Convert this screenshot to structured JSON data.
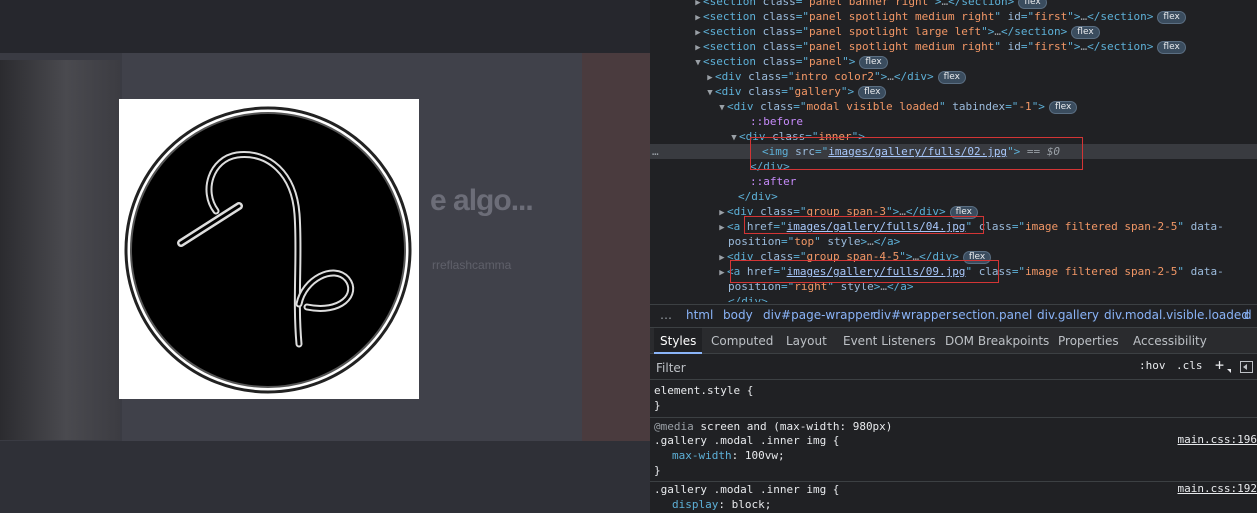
{
  "page": {
    "heading_partial": "e algo...",
    "subtext_partial": "rreflashcamma"
  },
  "elements_panel": {
    "lines": [
      {
        "toggle": "▶",
        "parts": [
          [
            "tg",
            "<section "
          ],
          [
            "an",
            "class"
          ],
          [
            "tg",
            "=\""
          ],
          [
            "av",
            "panel banner right"
          ],
          [
            "tg",
            "\">"
          ],
          [
            "eq",
            "…"
          ],
          [
            "tg",
            "</section>"
          ]
        ],
        "badge": "flex",
        "indent": 54
      },
      {
        "toggle": "▶",
        "parts": [
          [
            "tg",
            "<section "
          ],
          [
            "an",
            "class"
          ],
          [
            "tg",
            "=\""
          ],
          [
            "av",
            "panel spotlight medium right"
          ],
          [
            "tg",
            "\" "
          ],
          [
            "an",
            "id"
          ],
          [
            "tg",
            "=\""
          ],
          [
            "av",
            "first"
          ],
          [
            "tg",
            "\">"
          ],
          [
            "eq",
            "…"
          ],
          [
            "tg",
            "</section>"
          ]
        ],
        "badge": "flex",
        "indent": 54
      },
      {
        "toggle": "▶",
        "parts": [
          [
            "tg",
            "<section "
          ],
          [
            "an",
            "class"
          ],
          [
            "tg",
            "=\""
          ],
          [
            "av",
            "panel spotlight large left"
          ],
          [
            "tg",
            "\">"
          ],
          [
            "eq",
            "…"
          ],
          [
            "tg",
            "</section>"
          ]
        ],
        "badge": "flex",
        "indent": 54
      },
      {
        "toggle": "▶",
        "parts": [
          [
            "tg",
            "<section "
          ],
          [
            "an",
            "class"
          ],
          [
            "tg",
            "=\""
          ],
          [
            "av",
            "panel spotlight medium right"
          ],
          [
            "tg",
            "\" "
          ],
          [
            "an",
            "id"
          ],
          [
            "tg",
            "=\""
          ],
          [
            "av",
            "first"
          ],
          [
            "tg",
            "\">"
          ],
          [
            "eq",
            "…"
          ],
          [
            "tg",
            "</section>"
          ]
        ],
        "badge": "flex",
        "indent": 54
      },
      {
        "toggle": "▼",
        "parts": [
          [
            "tg",
            "<section "
          ],
          [
            "an",
            "class"
          ],
          [
            "tg",
            "=\""
          ],
          [
            "av",
            "panel"
          ],
          [
            "tg",
            "\">"
          ]
        ],
        "badge": "flex",
        "indent": 54
      },
      {
        "toggle": "▶",
        "parts": [
          [
            "tg",
            "<div "
          ],
          [
            "an",
            "class"
          ],
          [
            "tg",
            "=\""
          ],
          [
            "av",
            "intro color2"
          ],
          [
            "tg",
            "\">"
          ],
          [
            "eq",
            "…"
          ],
          [
            "tg",
            "</div>"
          ]
        ],
        "badge": "flex",
        "indent": 66
      },
      {
        "toggle": "▼",
        "parts": [
          [
            "tg",
            "<div "
          ],
          [
            "an",
            "class"
          ],
          [
            "tg",
            "=\""
          ],
          [
            "av",
            "gallery"
          ],
          [
            "tg",
            "\">"
          ]
        ],
        "badge": "flex",
        "indent": 66
      },
      {
        "toggle": "▼",
        "parts": [
          [
            "tg",
            "<div "
          ],
          [
            "an",
            "class"
          ],
          [
            "tg",
            "=\""
          ],
          [
            "av",
            "modal visible loaded"
          ],
          [
            "tg",
            "\" "
          ],
          [
            "an",
            "tabindex"
          ],
          [
            "tg",
            "=\""
          ],
          [
            "av",
            "-1"
          ],
          [
            "tg",
            "\">"
          ]
        ],
        "badge": "flex",
        "indent": 78
      },
      {
        "toggle": "",
        "parts": [
          [
            "pe",
            "::before"
          ]
        ],
        "badge": "",
        "indent": 100
      },
      {
        "toggle": "▼",
        "parts": [
          [
            "tg",
            "<div "
          ],
          [
            "an",
            "class"
          ],
          [
            "tg",
            "=\""
          ],
          [
            "av",
            "inner"
          ],
          [
            "tg",
            "\">"
          ]
        ],
        "badge": "",
        "indent": 90
      },
      {
        "toggle": "",
        "parts": [
          [
            "tg",
            "<img "
          ],
          [
            "an",
            "src"
          ],
          [
            "tg",
            "=\""
          ],
          [
            "avl",
            "images/gallery/fulls/02.jpg"
          ],
          [
            "tg",
            "\">"
          ],
          [
            "eq",
            " == "
          ],
          [
            "eqv",
            "$0"
          ]
        ],
        "badge": "",
        "indent": 112,
        "selected": true
      },
      {
        "toggle": "",
        "parts": [
          [
            "tg",
            "</div>"
          ]
        ],
        "badge": "",
        "indent": 100
      },
      {
        "toggle": "",
        "parts": [
          [
            "pe",
            "::after"
          ]
        ],
        "badge": "",
        "indent": 100
      },
      {
        "toggle": "",
        "parts": [
          [
            "tg",
            "</div>"
          ]
        ],
        "badge": "",
        "indent": 88
      },
      {
        "toggle": "▶",
        "parts": [
          [
            "tg",
            "<div "
          ],
          [
            "an",
            "class"
          ],
          [
            "tg",
            "=\""
          ],
          [
            "av",
            "group span-3"
          ],
          [
            "tg",
            "\">"
          ],
          [
            "eq",
            "…"
          ],
          [
            "tg",
            "</div>"
          ]
        ],
        "badge": "flex",
        "indent": 78
      },
      {
        "toggle": "▶",
        "parts": [
          [
            "tg",
            "<a "
          ],
          [
            "an",
            "href"
          ],
          [
            "tg",
            "=\""
          ],
          [
            "avl",
            "images/gallery/fulls/04.jpg"
          ],
          [
            "tg",
            "\" "
          ],
          [
            "an",
            "class"
          ],
          [
            "tg",
            "=\""
          ],
          [
            "av",
            "image filtered span-2-5"
          ],
          [
            "tg",
            "\" "
          ],
          [
            "an",
            "data-"
          ]
        ],
        "badge": "",
        "indent": 78
      },
      {
        "toggle": "",
        "parts": [
          [
            "an",
            "position"
          ],
          [
            "tg",
            "=\""
          ],
          [
            "av",
            "top"
          ],
          [
            "tg",
            "\" "
          ],
          [
            "an",
            "style"
          ],
          [
            "tg",
            ">"
          ],
          [
            "eq",
            "…"
          ],
          [
            "tg",
            "</a>"
          ]
        ],
        "badge": "",
        "indent": 78
      },
      {
        "toggle": "▶",
        "parts": [
          [
            "tg",
            "<div "
          ],
          [
            "an",
            "class"
          ],
          [
            "tg",
            "=\""
          ],
          [
            "av",
            "group span-4-5"
          ],
          [
            "tg",
            "\">"
          ],
          [
            "eq",
            "…"
          ],
          [
            "tg",
            "</div>"
          ]
        ],
        "badge": "flex",
        "indent": 78
      },
      {
        "toggle": "▶",
        "parts": [
          [
            "tg",
            "<a "
          ],
          [
            "an",
            "href"
          ],
          [
            "tg",
            "=\""
          ],
          [
            "avl",
            "images/gallery/fulls/09.jpg"
          ],
          [
            "tg",
            "\" "
          ],
          [
            "an",
            "class"
          ],
          [
            "tg",
            "=\""
          ],
          [
            "av",
            "image filtered span-2-5"
          ],
          [
            "tg",
            "\" "
          ],
          [
            "an",
            "data-"
          ]
        ],
        "badge": "",
        "indent": 78
      },
      {
        "toggle": "",
        "parts": [
          [
            "an",
            "position"
          ],
          [
            "tg",
            "=\""
          ],
          [
            "av",
            "right"
          ],
          [
            "tg",
            "\" "
          ],
          [
            "an",
            "style"
          ],
          [
            "tg",
            ">"
          ],
          [
            "eq",
            "…"
          ],
          [
            "tg",
            "</a>"
          ]
        ],
        "badge": "",
        "indent": 78
      },
      {
        "toggle": "",
        "parts": [
          [
            "tg",
            "</div>"
          ]
        ],
        "badge": "",
        "indent": 78
      }
    ],
    "ellipsis": "…"
  },
  "breadcrumbs": {
    "more": "…",
    "items": [
      "html",
      "body",
      "div#page-wrapper",
      "div#wrapper",
      "section.panel",
      "div.gallery",
      "div.modal.visible.loaded",
      "d"
    ]
  },
  "tabs": [
    "Styles",
    "Computed",
    "Layout",
    "Event Listeners",
    "DOM Breakpoints",
    "Properties",
    "Accessibility"
  ],
  "filter": {
    "placeholder": "Filter",
    "hov": ":hov",
    "cls": ".cls",
    "plus": "+"
  },
  "styles": {
    "element_style": "element.style {",
    "close1": "}",
    "media_keyword": "@media",
    "media_query": "screen and (max-width: 980px)",
    "rule1_selector": ".gallery .modal .inner img {",
    "rule1_prop": "max-width",
    "rule1_value": "100vw;",
    "rule1_source": "main.css:196",
    "close2": "}",
    "rule2_selector": ".gallery .modal .inner img {",
    "rule2_prop": "display",
    "rule2_value": "block;",
    "rule2_source": "main.css:192"
  },
  "colors": {
    "selected_row": "#393b40",
    "highlight_box": "#d33535",
    "tag": "#5db0d7",
    "attr_value": "#f29766"
  }
}
